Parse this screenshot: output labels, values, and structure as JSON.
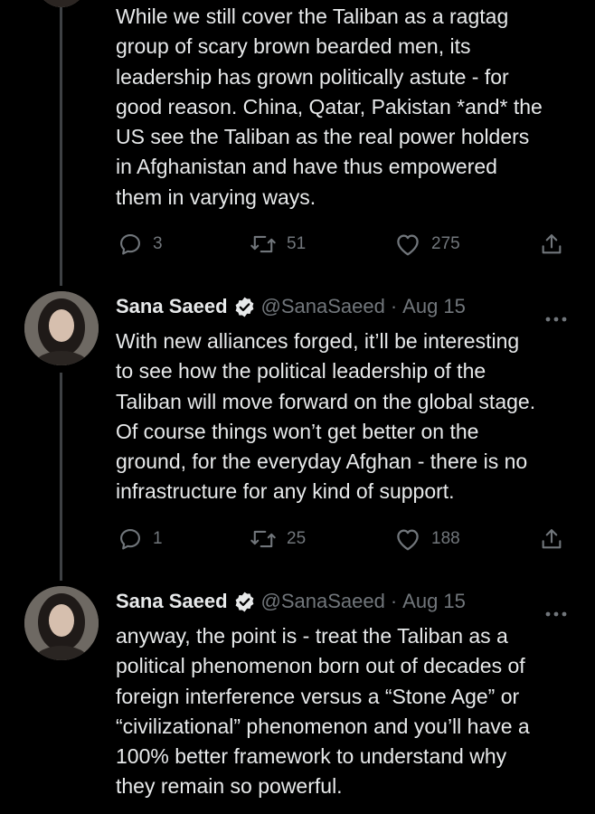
{
  "tweets": [
    {
      "body": "While we still cover the Taliban as a ragtag\ngroup of scary brown bearded men, its\nleadership has grown politically astute - for\ngood reason. China, Qatar, Pakistan *and* the\nUS see the Taliban as the real power holders\nin Afghanistan and have thus empowered\nthem in varying ways.",
      "replies": "3",
      "retweets": "51",
      "likes": "275"
    },
    {
      "name": "Sana Saeed",
      "handle": "@SanaSaeed",
      "separator": "·",
      "date": "Aug 15",
      "body": "With new alliances forged, it’ll be interesting\nto see how the political leadership of the\nTaliban will move forward on the global stage.\nOf course things won’t get better on the\nground, for the everyday Afghan - there is no\ninfrastructure for any kind of support.",
      "replies": "1",
      "retweets": "25",
      "likes": "188"
    },
    {
      "name": "Sana Saeed",
      "handle": "@SanaSaeed",
      "separator": "·",
      "date": "Aug 15",
      "body": "anyway, the point is - treat the Taliban as a\npolitical phenomenon born out of decades of\nforeign interference versus a “Stone Age” or\n“civilizational” phenomenon and you’ll have a\n100% better framework to understand why\nthey remain so powerful."
    }
  ],
  "icons": {
    "reply": "reply-icon",
    "retweet": "retweet-icon",
    "like": "heart-icon",
    "share": "share-icon",
    "verified": "verified-badge-icon",
    "more": "more-options-icon"
  },
  "colors": {
    "background": "#000000",
    "text": "#e7e9ea",
    "muted": "#71767b",
    "thread_line": "#3e4144",
    "verified_badge": "#e7e9ea"
  }
}
